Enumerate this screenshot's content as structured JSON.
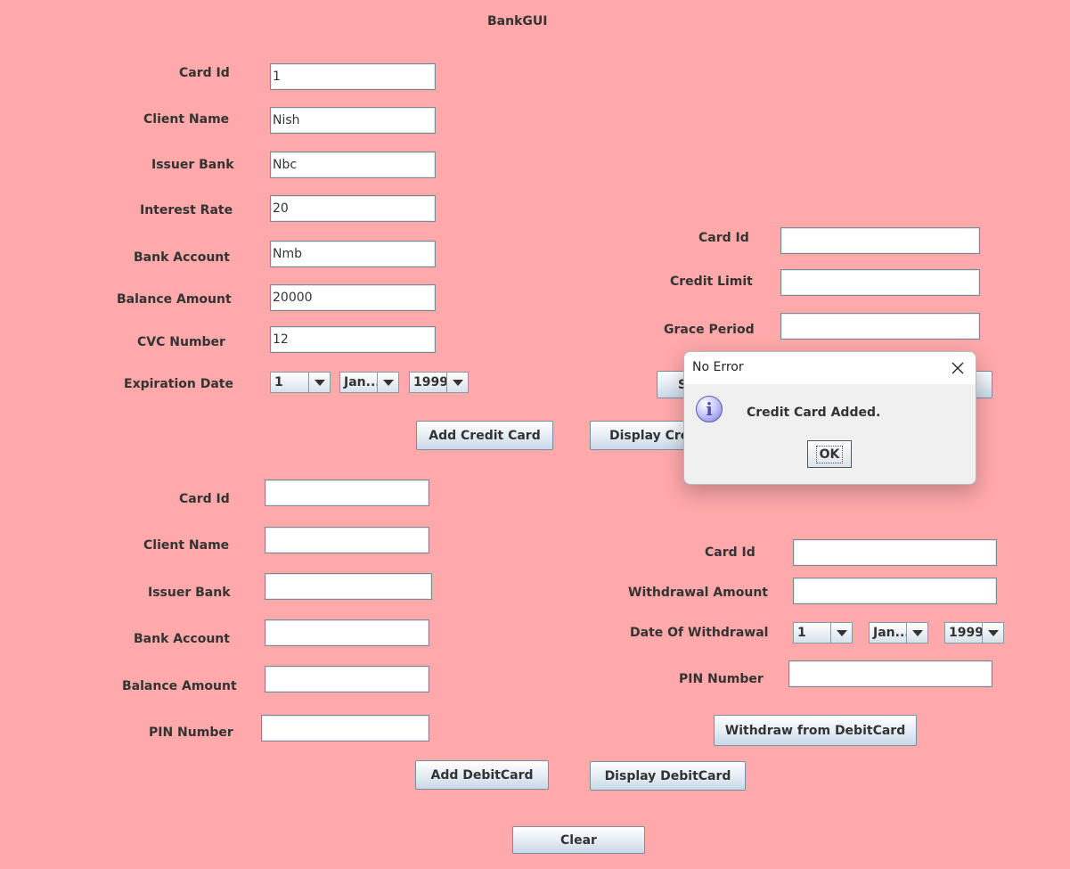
{
  "window": {
    "title": "BankGUI"
  },
  "credit_form": {
    "card_id": {
      "label": "Card Id",
      "value": "1"
    },
    "client_name": {
      "label": "Client Name",
      "value": "Nish"
    },
    "issuer_bank": {
      "label": "Issuer Bank",
      "value": "Nbc"
    },
    "interest_rate": {
      "label": "Interest Rate",
      "value": "20"
    },
    "bank_account": {
      "label": "Bank Account",
      "value": "Nmb"
    },
    "balance_amount": {
      "label": "Balance Amount",
      "value": "20000"
    },
    "cvc_number": {
      "label": "CVC Number",
      "value": "12"
    },
    "expiration_date": {
      "label": "Expiration Date",
      "day": "1",
      "month": "Jan...",
      "year": "1999"
    },
    "add_button": "Add Credit Card",
    "display_button": "Display Cred"
  },
  "credit_limit_form": {
    "card_id": {
      "label": "Card Id",
      "value": ""
    },
    "credit_limit": {
      "label": "Credit Limit",
      "value": ""
    },
    "grace_period": {
      "label": "Grace Period",
      "value": ""
    },
    "set_button": "S"
  },
  "debit_form": {
    "card_id": {
      "label": "Card Id",
      "value": ""
    },
    "client_name": {
      "label": "Client Name",
      "value": ""
    },
    "issuer_bank": {
      "label": "Issuer Bank",
      "value": ""
    },
    "bank_account": {
      "label": "Bank Account",
      "value": ""
    },
    "balance_amount": {
      "label": "Balance Amount",
      "value": ""
    },
    "pin_number": {
      "label": "PIN Number",
      "value": ""
    },
    "add_button": "Add DebitCard",
    "display_button": "Display DebitCard"
  },
  "withdraw_form": {
    "card_id": {
      "label": "Card Id",
      "value": ""
    },
    "withdrawal_amount": {
      "label": "Withdrawal Amount",
      "value": ""
    },
    "date_of_withdrawal": {
      "label": "Date Of Withdrawal",
      "day": "1",
      "month": "Jan...",
      "year": "1999"
    },
    "pin_number": {
      "label": "PIN Number",
      "value": ""
    },
    "withdraw_button": "Withdraw from DebitCard"
  },
  "clear_button": "Clear",
  "dialog": {
    "title": "No Error",
    "message": "Credit Card Added.",
    "ok_label": "OK",
    "icon": "info-icon"
  },
  "colors": {
    "background": "#ffa9aa",
    "field_background": "#ffffff",
    "button_gradient_top": "#ffffff",
    "button_gradient_bottom": "#c9d8e7",
    "dialog_background": "#f0f0f0"
  }
}
